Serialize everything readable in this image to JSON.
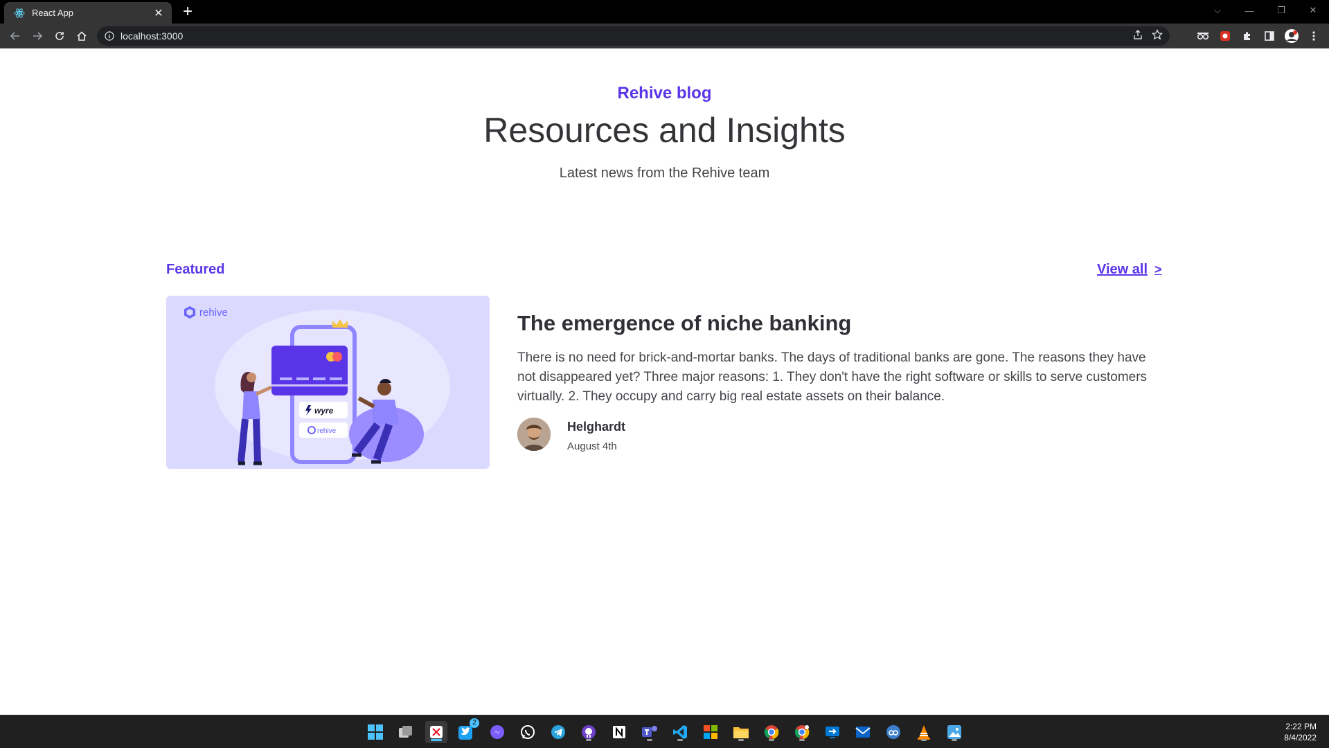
{
  "browser": {
    "tab_title": "React App",
    "tab_close": "✕",
    "new_tab": "+",
    "url": "localhost:3000",
    "window_controls": [
      "⌵",
      "—",
      "❐",
      "✕"
    ]
  },
  "blog": {
    "eyebrow": "Rehive blog",
    "title": "Resources and Insights",
    "subtitle": "Latest news from the Rehive team"
  },
  "featured": {
    "label": "Featured",
    "view_all": "View all",
    "view_all_chevron": ">",
    "image_brand": "rehive",
    "image_card_1": "wyre",
    "image_card_2": "rehive",
    "post": {
      "title": "The emergence of niche banking",
      "excerpt": "There is no need for brick-and-mortar banks. The days of traditional banks are gone. The reasons they have not disappeared yet? Three major reasons: 1. They don't have the right software or skills to serve customers virtually. 2. They occupy and carry big real estate assets on their balance.",
      "author": "Helghardt",
      "date": "August 4th"
    }
  },
  "taskbar": {
    "time": "2:22 PM",
    "date": "8/4/2022",
    "twitter_badge": "2",
    "apps": [
      "start-icon",
      "task-view-icon",
      "snipping-tool-icon",
      "twitter-icon",
      "messenger-icon",
      "whatsapp-icon",
      "telegram-icon",
      "github-icon",
      "notion-icon",
      "teams-icon",
      "vscode-icon",
      "app-grid-icon",
      "file-explorer-icon",
      "chrome-icon",
      "chrome-dev-icon",
      "remote-desktop-icon",
      "mail-icon",
      "qbittorrent-icon",
      "vlc-icon",
      "photos-icon"
    ]
  },
  "colors": {
    "accent": "#5a35e8",
    "text_dark": "#333438",
    "image_bg": "#dcd9ff"
  }
}
